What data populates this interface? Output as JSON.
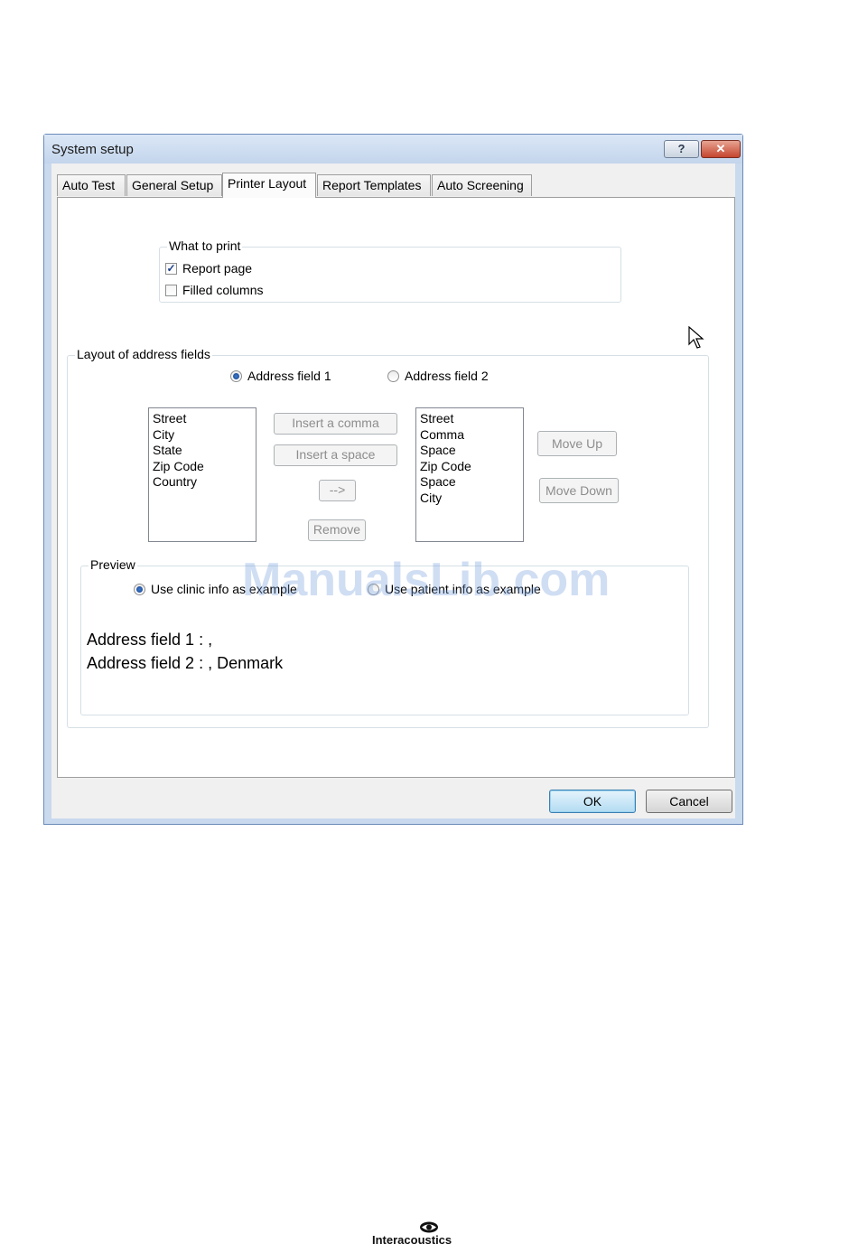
{
  "window": {
    "title": "System setup",
    "help_glyph": "?",
    "close_glyph": "✕"
  },
  "tabs": [
    {
      "label": "Auto Test",
      "active": false
    },
    {
      "label": "General Setup",
      "active": false
    },
    {
      "label": "Printer Layout",
      "active": true
    },
    {
      "label": "Report Templates",
      "active": false
    },
    {
      "label": "Auto Screening",
      "active": false
    }
  ],
  "what_to_print": {
    "legend": "What to print",
    "options": [
      {
        "label": "Report page",
        "checked": true
      },
      {
        "label": "Filled columns",
        "checked": false
      }
    ]
  },
  "address_layout": {
    "legend": "Layout of address fields",
    "radio_field1": {
      "label": "Address field 1",
      "selected": true
    },
    "radio_field2": {
      "label": "Address field 2",
      "selected": false
    },
    "available_fields": [
      "Street",
      "City",
      "State",
      "Zip Code",
      "Country"
    ],
    "selected_fields": [
      "Street",
      "Comma",
      "Space",
      "Zip Code",
      "Space",
      "City"
    ],
    "insert_comma_label": "Insert a comma",
    "insert_space_label": "Insert a space",
    "arrow_label": "-->",
    "remove_label": "Remove",
    "move_up_label": "Move Up",
    "move_down_label": "Move Down"
  },
  "preview": {
    "legend": "Preview",
    "radio_clinic": {
      "label": "Use clinic info as example",
      "selected": true
    },
    "radio_patient": {
      "label": "Use patient info as example",
      "selected": false
    },
    "line1": "Address field 1 :  ,",
    "line2": "Address field 2 : , Denmark"
  },
  "dialog_buttons": {
    "ok_label": "OK",
    "cancel_label": "Cancel"
  },
  "watermark": "ManualsLib.com",
  "footer": {
    "brand": "Interacoustics"
  },
  "colors": {
    "accent_blue": "#3c7fb1",
    "close_red": "#c4452e",
    "disabled_text": "#8d8d8d"
  }
}
